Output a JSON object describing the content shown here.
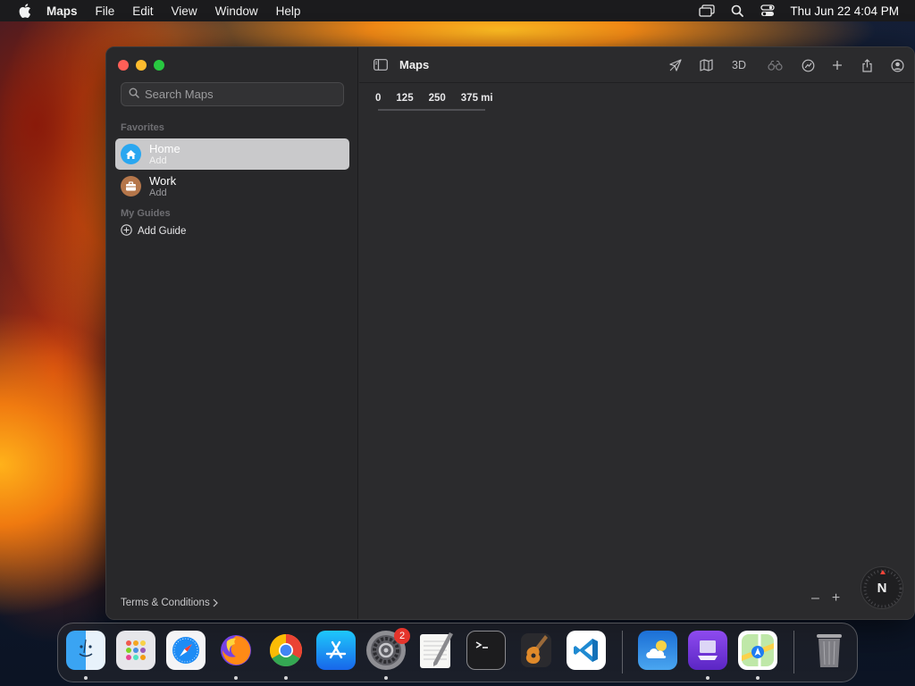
{
  "menubar": {
    "app_name": "Maps",
    "items": [
      "File",
      "Edit",
      "View",
      "Window",
      "Help"
    ],
    "clock": "Thu Jun 22  4:04 PM",
    "icons": [
      "apple-icon",
      "screen-mirroring-icon",
      "spotlight-search-icon",
      "control-center-icon"
    ]
  },
  "window": {
    "title": "Maps",
    "search": {
      "placeholder": "Search Maps"
    },
    "favorites_header": "Favorites",
    "favorites": [
      {
        "name": "Home",
        "subtitle": "Add",
        "icon": "house-icon",
        "color": "#2aa7f0",
        "selected": true
      },
      {
        "name": "Work",
        "subtitle": "Add",
        "icon": "briefcase-icon",
        "color": "#b5764a",
        "selected": false
      }
    ],
    "guides_header": "My Guides",
    "add_guide": "Add Guide",
    "terms": "Terms & Conditions",
    "toolbar": {
      "three_d_label": "3D",
      "icons": [
        "location-arrow-icon",
        "map-mode-icon",
        "look-around-icon",
        "track-icon",
        "add-icon",
        "share-icon",
        "account-icon"
      ]
    },
    "scale": [
      "0",
      "125",
      "250",
      "375 mi"
    ],
    "zoom_out": "–",
    "zoom_in": "+",
    "compass": "N"
  },
  "dock": {
    "apps": [
      "Finder",
      "Launchpad",
      "Safari",
      "Firefox",
      "Chrome",
      "App Store",
      "System Settings",
      "TextEdit",
      "Terminal",
      "GarageBand",
      "Visual Studio Code",
      "Weather",
      "Simulator",
      "Maps",
      "Trash"
    ],
    "notification_badge": "2"
  },
  "colors": {
    "menubar": "#1b1b1d",
    "sidebar": "#28282a",
    "map": "#2b2b2d",
    "selection": "#c9c9cb"
  }
}
